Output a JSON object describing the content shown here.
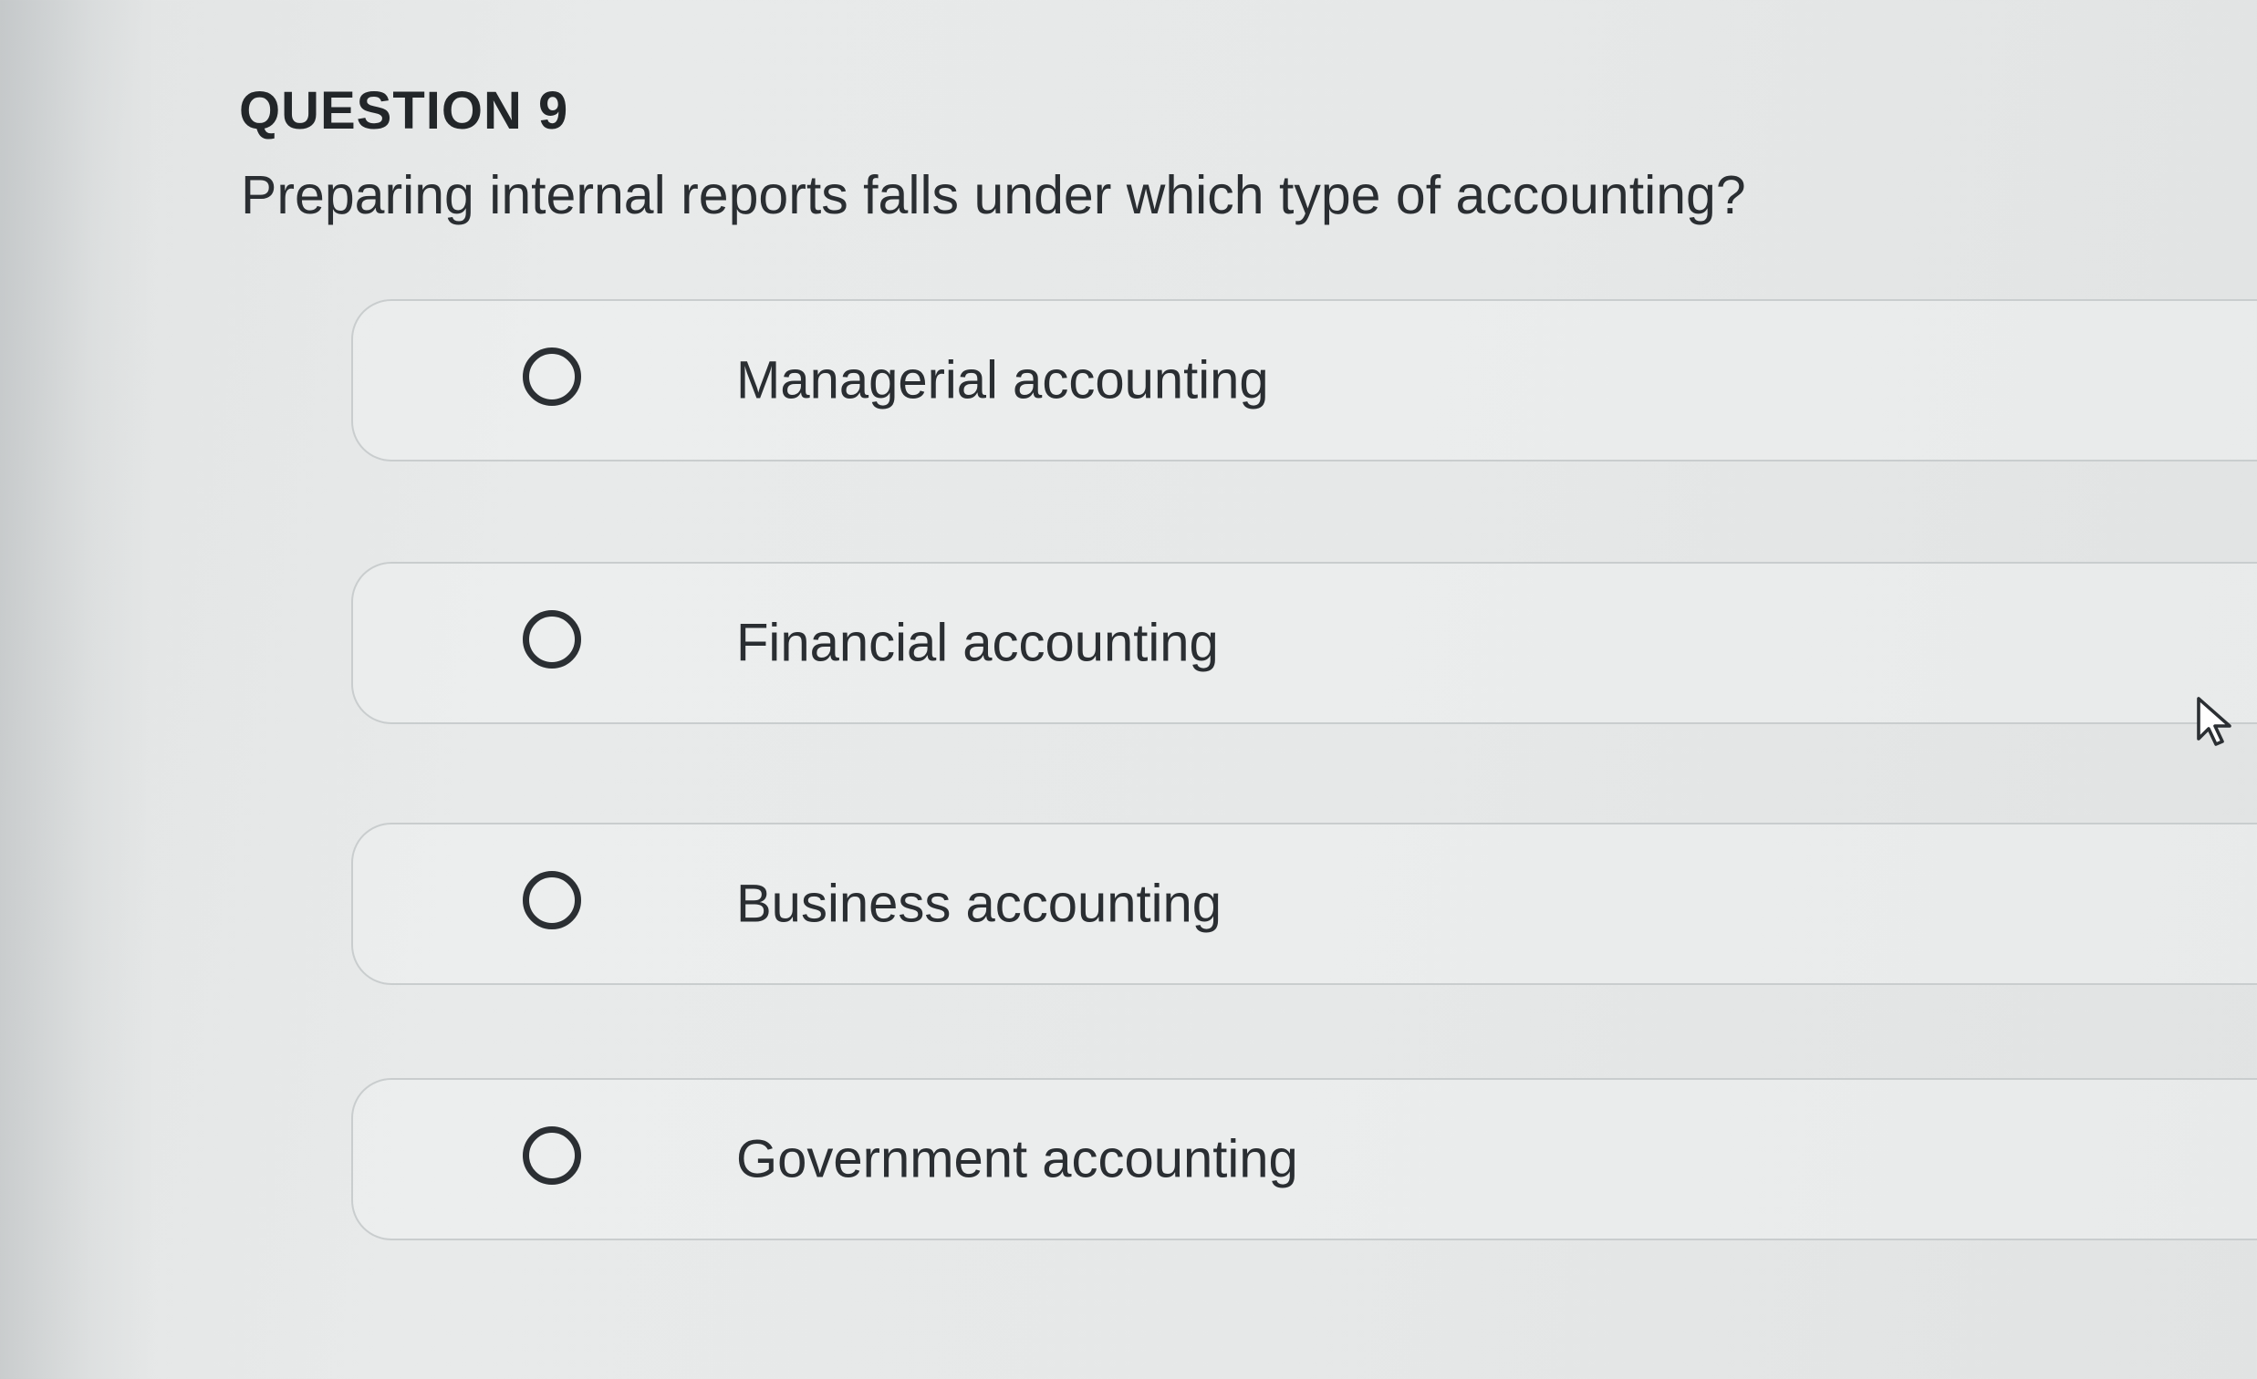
{
  "question": {
    "header": "QUESTION 9",
    "text": "Preparing internal reports falls under which type of accounting?"
  },
  "options": [
    {
      "label": "Managerial accounting",
      "selected": false
    },
    {
      "label": "Financial accounting",
      "selected": false
    },
    {
      "label": "Business accounting",
      "selected": false
    },
    {
      "label": "Government accounting",
      "selected": false
    }
  ],
  "icons": {
    "radio": "radio-unselected-icon",
    "cursor": "mouse-pointer-icon"
  },
  "colors": {
    "background": "#e6e8e8",
    "text": "#2a2e32",
    "option_border": "#c9cdce"
  }
}
